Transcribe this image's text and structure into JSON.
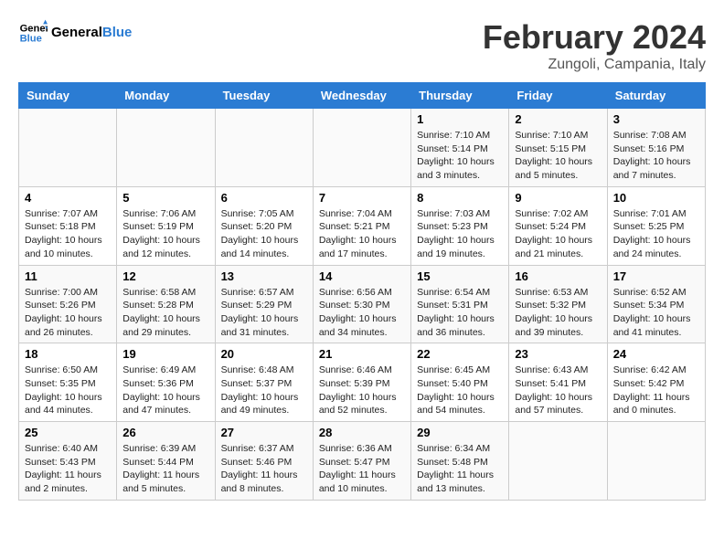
{
  "header": {
    "logo_line1": "General",
    "logo_line2": "Blue",
    "month_year": "February 2024",
    "location": "Zungoli, Campania, Italy"
  },
  "weekdays": [
    "Sunday",
    "Monday",
    "Tuesday",
    "Wednesday",
    "Thursday",
    "Friday",
    "Saturday"
  ],
  "weeks": [
    [
      {
        "day": "",
        "info": ""
      },
      {
        "day": "",
        "info": ""
      },
      {
        "day": "",
        "info": ""
      },
      {
        "day": "",
        "info": ""
      },
      {
        "day": "1",
        "info": "Sunrise: 7:10 AM\nSunset: 5:14 PM\nDaylight: 10 hours\nand 3 minutes."
      },
      {
        "day": "2",
        "info": "Sunrise: 7:10 AM\nSunset: 5:15 PM\nDaylight: 10 hours\nand 5 minutes."
      },
      {
        "day": "3",
        "info": "Sunrise: 7:08 AM\nSunset: 5:16 PM\nDaylight: 10 hours\nand 7 minutes."
      }
    ],
    [
      {
        "day": "4",
        "info": "Sunrise: 7:07 AM\nSunset: 5:18 PM\nDaylight: 10 hours\nand 10 minutes."
      },
      {
        "day": "5",
        "info": "Sunrise: 7:06 AM\nSunset: 5:19 PM\nDaylight: 10 hours\nand 12 minutes."
      },
      {
        "day": "6",
        "info": "Sunrise: 7:05 AM\nSunset: 5:20 PM\nDaylight: 10 hours\nand 14 minutes."
      },
      {
        "day": "7",
        "info": "Sunrise: 7:04 AM\nSunset: 5:21 PM\nDaylight: 10 hours\nand 17 minutes."
      },
      {
        "day": "8",
        "info": "Sunrise: 7:03 AM\nSunset: 5:23 PM\nDaylight: 10 hours\nand 19 minutes."
      },
      {
        "day": "9",
        "info": "Sunrise: 7:02 AM\nSunset: 5:24 PM\nDaylight: 10 hours\nand 21 minutes."
      },
      {
        "day": "10",
        "info": "Sunrise: 7:01 AM\nSunset: 5:25 PM\nDaylight: 10 hours\nand 24 minutes."
      }
    ],
    [
      {
        "day": "11",
        "info": "Sunrise: 7:00 AM\nSunset: 5:26 PM\nDaylight: 10 hours\nand 26 minutes."
      },
      {
        "day": "12",
        "info": "Sunrise: 6:58 AM\nSunset: 5:28 PM\nDaylight: 10 hours\nand 29 minutes."
      },
      {
        "day": "13",
        "info": "Sunrise: 6:57 AM\nSunset: 5:29 PM\nDaylight: 10 hours\nand 31 minutes."
      },
      {
        "day": "14",
        "info": "Sunrise: 6:56 AM\nSunset: 5:30 PM\nDaylight: 10 hours\nand 34 minutes."
      },
      {
        "day": "15",
        "info": "Sunrise: 6:54 AM\nSunset: 5:31 PM\nDaylight: 10 hours\nand 36 minutes."
      },
      {
        "day": "16",
        "info": "Sunrise: 6:53 AM\nSunset: 5:32 PM\nDaylight: 10 hours\nand 39 minutes."
      },
      {
        "day": "17",
        "info": "Sunrise: 6:52 AM\nSunset: 5:34 PM\nDaylight: 10 hours\nand 41 minutes."
      }
    ],
    [
      {
        "day": "18",
        "info": "Sunrise: 6:50 AM\nSunset: 5:35 PM\nDaylight: 10 hours\nand 44 minutes."
      },
      {
        "day": "19",
        "info": "Sunrise: 6:49 AM\nSunset: 5:36 PM\nDaylight: 10 hours\nand 47 minutes."
      },
      {
        "day": "20",
        "info": "Sunrise: 6:48 AM\nSunset: 5:37 PM\nDaylight: 10 hours\nand 49 minutes."
      },
      {
        "day": "21",
        "info": "Sunrise: 6:46 AM\nSunset: 5:39 PM\nDaylight: 10 hours\nand 52 minutes."
      },
      {
        "day": "22",
        "info": "Sunrise: 6:45 AM\nSunset: 5:40 PM\nDaylight: 10 hours\nand 54 minutes."
      },
      {
        "day": "23",
        "info": "Sunrise: 6:43 AM\nSunset: 5:41 PM\nDaylight: 10 hours\nand 57 minutes."
      },
      {
        "day": "24",
        "info": "Sunrise: 6:42 AM\nSunset: 5:42 PM\nDaylight: 11 hours\nand 0 minutes."
      }
    ],
    [
      {
        "day": "25",
        "info": "Sunrise: 6:40 AM\nSunset: 5:43 PM\nDaylight: 11 hours\nand 2 minutes."
      },
      {
        "day": "26",
        "info": "Sunrise: 6:39 AM\nSunset: 5:44 PM\nDaylight: 11 hours\nand 5 minutes."
      },
      {
        "day": "27",
        "info": "Sunrise: 6:37 AM\nSunset: 5:46 PM\nDaylight: 11 hours\nand 8 minutes."
      },
      {
        "day": "28",
        "info": "Sunrise: 6:36 AM\nSunset: 5:47 PM\nDaylight: 11 hours\nand 10 minutes."
      },
      {
        "day": "29",
        "info": "Sunrise: 6:34 AM\nSunset: 5:48 PM\nDaylight: 11 hours\nand 13 minutes."
      },
      {
        "day": "",
        "info": ""
      },
      {
        "day": "",
        "info": ""
      }
    ]
  ]
}
